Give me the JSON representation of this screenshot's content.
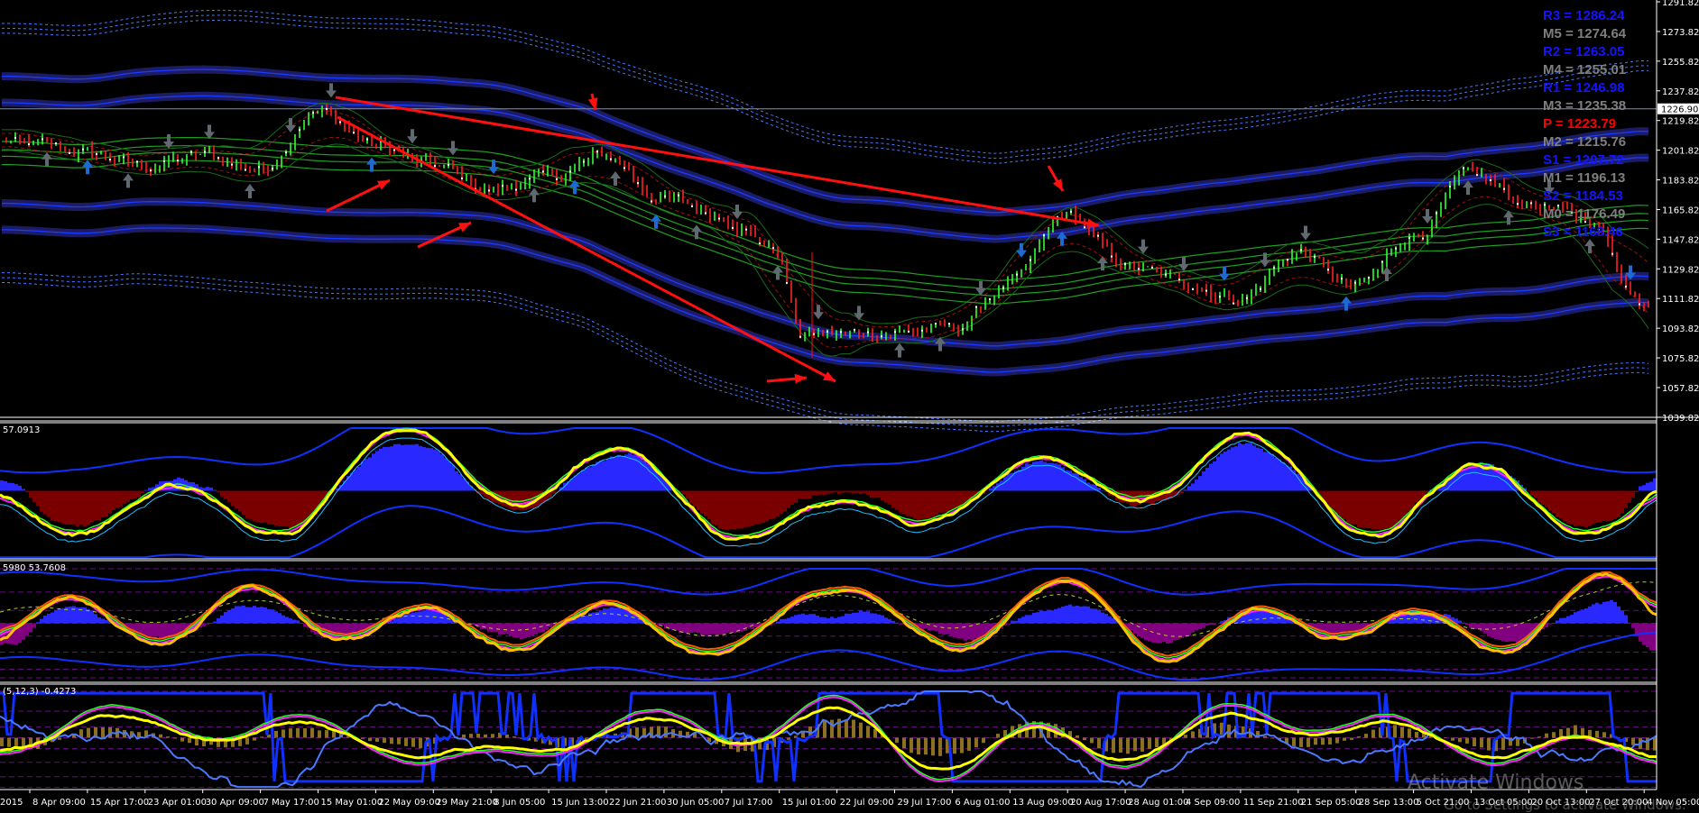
{
  "colors": {
    "background": "#000000",
    "axis": "#ffffff",
    "bull": "#33ff33",
    "bear": "#ff2020",
    "band": "#1c1c66",
    "band_core": "#1a3cff",
    "dotted": "#4a78ff",
    "trendline": "#ff1010",
    "pivot_resistance": "#1414ff",
    "pivot_mid": "#7f7f7f",
    "pivot_pivot": "#ff0000",
    "osc_main": "#ffff00",
    "hist_up": "#2828ff",
    "hist_down": "#7a0000",
    "hist2_down": "#800080"
  },
  "pivots": [
    {
      "label": "R3 = 1286.24",
      "kind": "resistance"
    },
    {
      "label": "M5 = 1274.64",
      "kind": "mid"
    },
    {
      "label": "R2 = 1263.05",
      "kind": "resistance"
    },
    {
      "label": "M4 = 1255.01",
      "kind": "mid"
    },
    {
      "label": "R1 = 1246.98",
      "kind": "resistance"
    },
    {
      "label": "M3 = 1235.38",
      "kind": "mid"
    },
    {
      "label": "P   = 1223.79",
      "kind": "pivot"
    },
    {
      "label": "M2 = 1215.76",
      "kind": "mid"
    },
    {
      "label": "S1 = 1207.72",
      "kind": "resistance"
    },
    {
      "label": "M1 = 1196.13",
      "kind": "mid"
    },
    {
      "label": "S2 = 1184.53",
      "kind": "resistance"
    },
    {
      "label": "M0 = 1176.49",
      "kind": "mid"
    },
    {
      "label": "S3 = 1168.46",
      "kind": "resistance"
    }
  ],
  "subwindows": {
    "osc1_label": "57.0913",
    "osc2_label": "5980 53.7608",
    "osc3_label": "(5,12,3) -0.4273"
  },
  "watermark": {
    "line1": "Activate Windows",
    "line2": "Go to Settings to activate Windows."
  },
  "chart_data": {
    "type": "line",
    "title": "",
    "current_price": "1226.90",
    "y_ticks": [
      "1291.82",
      "1273.82",
      "1255.82",
      "1237.82",
      "1219.82",
      "1201.82",
      "1183.82",
      "1165.82",
      "1147.82",
      "1129.82",
      "1111.82",
      "1093.82",
      "1075.82",
      "1057.82",
      "1039.82"
    ],
    "ylim": [
      1039.82,
      1291.82
    ],
    "x_ticks": [
      "2015",
      "8 Apr 09:00",
      "15 Apr 17:00",
      "23 Apr 01:00",
      "30 Apr 09:00",
      "7 May 17:00",
      "15 May 01:00",
      "22 May 09:00",
      "29 May 21:00",
      "8 Jun 05:00",
      "15 Jun 13:00",
      "22 Jun 21:00",
      "30 Jun 05:00",
      "7 Jul 17:00",
      "15 Jul 01:00",
      "22 Jul 09:00",
      "29 Jul 17:00",
      "6 Aug 01:00",
      "13 Aug 09:00",
      "20 Aug 17:00",
      "28 Aug 01:00",
      "4 Sep 09:00",
      "11 Sep 21:00",
      "21 Sep 05:00",
      "28 Sep 13:00",
      "5 Oct 21:00",
      "13 Oct 05:00",
      "20 Oct 13:00",
      "27 Oct 20:00",
      "4 Nov 05:00"
    ],
    "approx_close": [
      1212,
      1205,
      1200,
      1192,
      1198,
      1190,
      1226,
      1205,
      1192,
      1178,
      1185,
      1198,
      1172,
      1162,
      1142,
      1090,
      1092,
      1093,
      1120,
      1162,
      1132,
      1122,
      1112,
      1140,
      1118,
      1150,
      1186,
      1170,
      1160,
      1110
    ],
    "trendlines": [
      {
        "from": [
          "15 May 01:00",
          1232
        ],
        "to": [
          "20 Aug 17:00",
          1166
        ]
      },
      {
        "from": [
          "15 May 01:00",
          1218
        ],
        "to": [
          "15 Jul 01:00",
          1066
        ]
      }
    ],
    "osc1_ticks": [
      "100",
      "32",
      "0"
    ],
    "osc2_ticks": [
      "105",
      "78.6",
      "61.8",
      "50",
      "38.2",
      "23.6",
      "8",
      "0500"
    ],
    "osc3_ticks": [
      "100.8436",
      "78.6",
      "61.8",
      "50.00",
      "38.2",
      "23.6",
      "8",
      "-3.5299"
    ]
  }
}
